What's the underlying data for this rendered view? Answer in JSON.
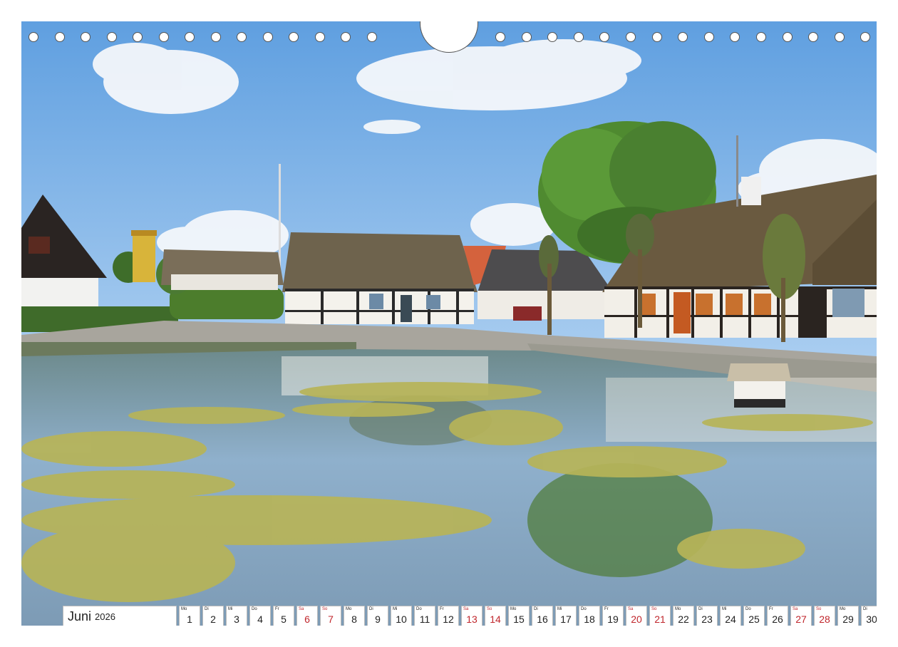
{
  "calendar": {
    "month": "Juni",
    "year": "2026",
    "days": [
      {
        "wd": "Mo",
        "num": "1",
        "weekend": false
      },
      {
        "wd": "Di",
        "num": "2",
        "weekend": false
      },
      {
        "wd": "Mi",
        "num": "3",
        "weekend": false
      },
      {
        "wd": "Do",
        "num": "4",
        "weekend": false
      },
      {
        "wd": "Fr",
        "num": "5",
        "weekend": false
      },
      {
        "wd": "Sa",
        "num": "6",
        "weekend": true
      },
      {
        "wd": "So",
        "num": "7",
        "weekend": true
      },
      {
        "wd": "Mo",
        "num": "8",
        "weekend": false
      },
      {
        "wd": "Di",
        "num": "9",
        "weekend": false
      },
      {
        "wd": "Mi",
        "num": "10",
        "weekend": false
      },
      {
        "wd": "Do",
        "num": "11",
        "weekend": false
      },
      {
        "wd": "Fr",
        "num": "12",
        "weekend": false
      },
      {
        "wd": "Sa",
        "num": "13",
        "weekend": true
      },
      {
        "wd": "So",
        "num": "14",
        "weekend": true
      },
      {
        "wd": "Mo",
        "num": "15",
        "weekend": false
      },
      {
        "wd": "Di",
        "num": "16",
        "weekend": false
      },
      {
        "wd": "Mi",
        "num": "17",
        "weekend": false
      },
      {
        "wd": "Do",
        "num": "18",
        "weekend": false
      },
      {
        "wd": "Fr",
        "num": "19",
        "weekend": false
      },
      {
        "wd": "Sa",
        "num": "20",
        "weekend": true
      },
      {
        "wd": "So",
        "num": "21",
        "weekend": true
      },
      {
        "wd": "Mo",
        "num": "22",
        "weekend": false
      },
      {
        "wd": "Di",
        "num": "23",
        "weekend": false
      },
      {
        "wd": "Mi",
        "num": "24",
        "weekend": false
      },
      {
        "wd": "Do",
        "num": "25",
        "weekend": false
      },
      {
        "wd": "Fr",
        "num": "26",
        "weekend": false
      },
      {
        "wd": "Sa",
        "num": "27",
        "weekend": true
      },
      {
        "wd": "So",
        "num": "28",
        "weekend": true
      },
      {
        "wd": "Mo",
        "num": "29",
        "weekend": false
      },
      {
        "wd": "Di",
        "num": "30",
        "weekend": false
      }
    ]
  },
  "colors": {
    "weekend": "#c0262c",
    "weekday": "#222222"
  }
}
